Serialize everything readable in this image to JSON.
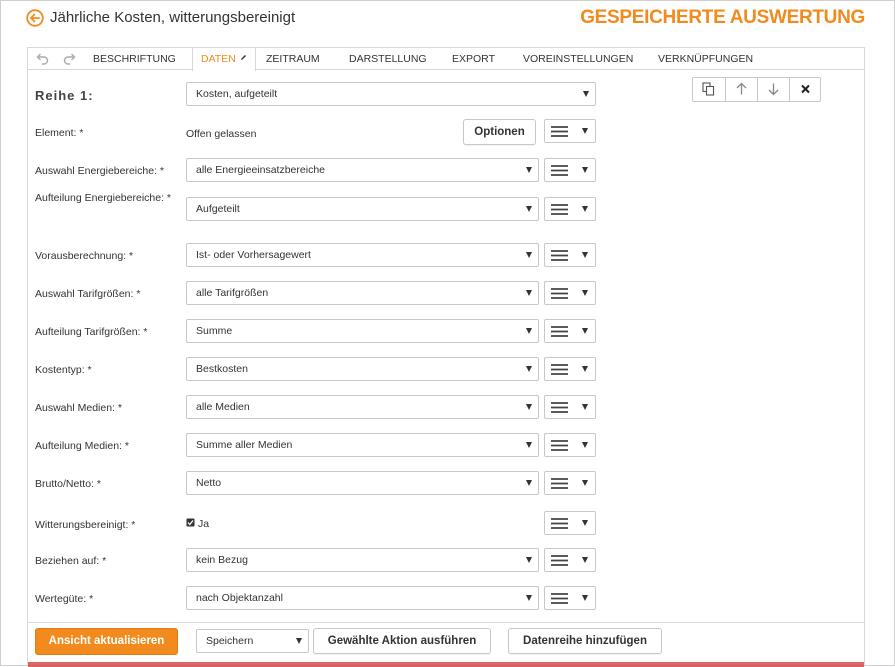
{
  "header": {
    "title": "Jährliche Kosten, witterungsbereinigt",
    "saved_label": "GESPEICHERTE AUSWERTUNG"
  },
  "tabs": [
    {
      "label": "BESCHRIFTUNG",
      "active": false
    },
    {
      "label": "DATEN",
      "active": true
    },
    {
      "label": "ZEITRAUM",
      "active": false
    },
    {
      "label": "DARSTELLUNG",
      "active": false
    },
    {
      "label": "EXPORT",
      "active": false
    },
    {
      "label": "VOREINSTELLUNGEN",
      "active": false
    },
    {
      "label": "VERKNÜPFUNGEN",
      "active": false
    }
  ],
  "series": {
    "heading": "Reihe 1:",
    "type_value": "Kosten, aufgeteilt"
  },
  "element_row": {
    "label": "Element: *",
    "value": "Offen gelassen",
    "options_button": "Optionen"
  },
  "fields": [
    {
      "label": "Auswahl Energiebereiche: *",
      "value": "alle Energieeinsatzbereiche"
    },
    {
      "label": "Aufteilung Energiebereiche: *",
      "value": "Aufgeteilt"
    },
    {
      "label": "Vorausberechnung: *",
      "value": "Ist- oder Vorhersagewert"
    },
    {
      "label": "Auswahl Tarifgrößen: *",
      "value": "alle Tarifgrößen"
    },
    {
      "label": "Aufteilung Tarifgrößen: *",
      "value": "Summe"
    },
    {
      "label": "Kostentyp: *",
      "value": "Bestkosten"
    },
    {
      "label": "Auswahl Medien: *",
      "value": "alle Medien"
    },
    {
      "label": "Aufteilung Medien: *",
      "value": "Summe aller Medien"
    },
    {
      "label": "Brutto/Netto: *",
      "value": "Netto"
    }
  ],
  "weather_row": {
    "label": "Witterungsbereinigt: *",
    "checkbox_label": "Ja",
    "checked": true
  },
  "fields_bottom": [
    {
      "label": "Beziehen auf: *",
      "value": "kein Bezug"
    },
    {
      "label": "Wertegüte: *",
      "value": "nach Objektanzahl"
    }
  ],
  "footer": {
    "refresh_button": "Ansicht aktualisieren",
    "action_select": "Speichern",
    "execute_button": "Gewählte Aktion ausführen",
    "add_series_button": "Datenreihe hinzufügen"
  },
  "colors": {
    "accent": "#f28a1e",
    "border": "#c8c8c8"
  }
}
